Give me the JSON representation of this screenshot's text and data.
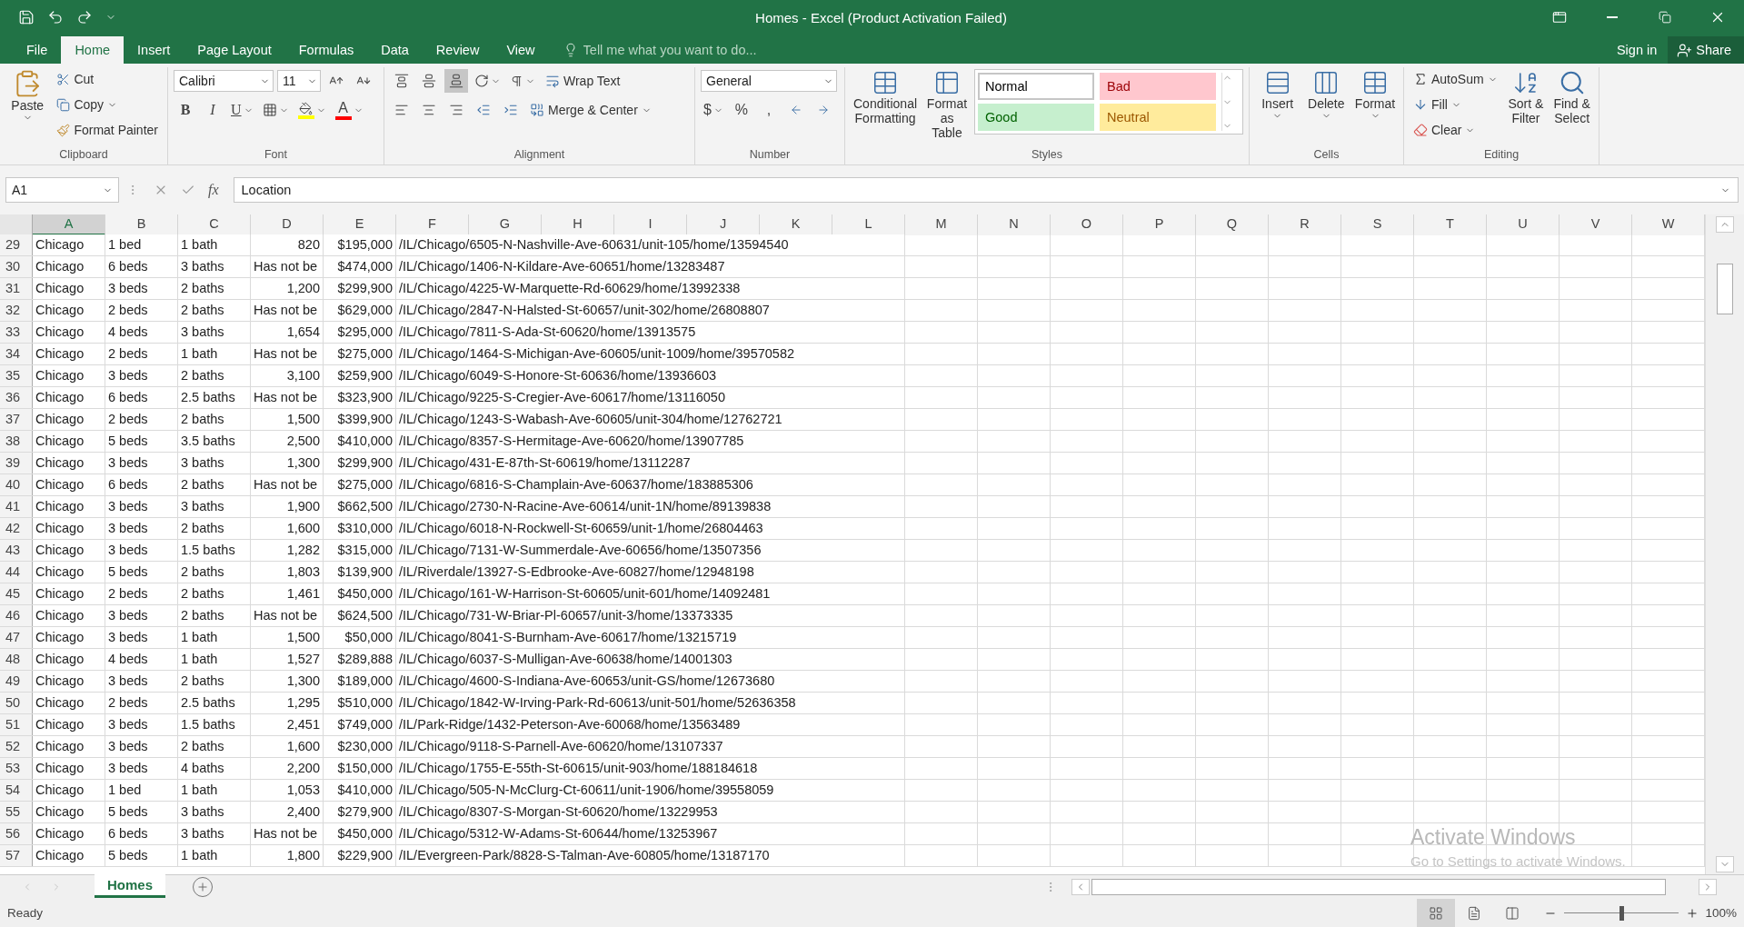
{
  "window": {
    "title": "Homes - Excel (Product Activation Failed)"
  },
  "menu_tabs": [
    {
      "label": "File",
      "selected": false
    },
    {
      "label": "Home",
      "selected": true
    },
    {
      "label": "Insert",
      "selected": false
    },
    {
      "label": "Page Layout",
      "selected": false
    },
    {
      "label": "Formulas",
      "selected": false
    },
    {
      "label": "Data",
      "selected": false
    },
    {
      "label": "Review",
      "selected": false
    },
    {
      "label": "View",
      "selected": false
    }
  ],
  "tell_me": {
    "placeholder": "Tell me what you want to do..."
  },
  "account": {
    "sign_in": "Sign in",
    "share": "Share"
  },
  "ribbon": {
    "clipboard": {
      "label": "Clipboard",
      "paste": "Paste",
      "cut": "Cut",
      "copy": "Copy",
      "format_painter": "Format Painter"
    },
    "font": {
      "label": "Font",
      "name": "Calibri",
      "size": "11",
      "bold": "B",
      "italic": "I",
      "underline": "U",
      "font_color": "A"
    },
    "alignment": {
      "label": "Alignment",
      "wrap_text": "Wrap Text",
      "merge_center": "Merge & Center"
    },
    "number": {
      "label": "Number",
      "format": "General",
      "currency": "$",
      "percent": "%",
      "comma": ","
    },
    "styles": {
      "label": "Styles",
      "conditional_formatting": "Conditional Formatting",
      "format_as_table": "Format as Table",
      "cell_styles": [
        {
          "label": "Normal",
          "kind": "normal"
        },
        {
          "label": "Bad",
          "kind": "bad"
        },
        {
          "label": "Good",
          "kind": "good"
        },
        {
          "label": "Neutral",
          "kind": "neutral"
        }
      ]
    },
    "cells": {
      "label": "Cells",
      "buttons": [
        "Insert",
        "Delete",
        "Format"
      ]
    },
    "editing": {
      "label": "Editing",
      "autosum": "AutoSum",
      "fill": "Fill",
      "clear": "Clear",
      "sort_filter": "Sort & Filter",
      "find_select": "Find & Select"
    }
  },
  "formula_bar": {
    "name_box": "A1",
    "fx": "fx",
    "value": "Location"
  },
  "columns": [
    {
      "label": "A",
      "selected": true
    },
    {
      "label": "B",
      "selected": false
    },
    {
      "label": "C",
      "selected": false
    },
    {
      "label": "D",
      "selected": false
    },
    {
      "label": "E",
      "selected": false
    },
    {
      "label": "F",
      "selected": false
    },
    {
      "label": "G",
      "selected": false
    },
    {
      "label": "H",
      "selected": false
    },
    {
      "label": "I",
      "selected": false
    },
    {
      "label": "J",
      "selected": false
    },
    {
      "label": "K",
      "selected": false
    },
    {
      "label": "L",
      "selected": false
    },
    {
      "label": "M",
      "selected": false
    },
    {
      "label": "N",
      "selected": false
    },
    {
      "label": "O",
      "selected": false
    },
    {
      "label": "P",
      "selected": false
    },
    {
      "label": "Q",
      "selected": false
    },
    {
      "label": "R",
      "selected": false
    },
    {
      "label": "S",
      "selected": false
    },
    {
      "label": "T",
      "selected": false
    },
    {
      "label": "U",
      "selected": false
    },
    {
      "label": "V",
      "selected": false
    },
    {
      "label": "W",
      "selected": false
    }
  ],
  "rows": [
    {
      "number": "29",
      "kind": "number",
      "cells": [
        "Chicago",
        "1 bed",
        "1 bath",
        "820",
        "$195,000",
        "/IL/Chicago/6505-N-Nashville-Ave-60631/unit-105/home/13594540"
      ]
    },
    {
      "number": "30",
      "kind": "text",
      "cells": [
        "Chicago",
        "6 beds",
        "3 baths",
        "Has not be",
        "$474,000",
        "/IL/Chicago/1406-N-Kildare-Ave-60651/home/13283487"
      ]
    },
    {
      "number": "31",
      "kind": "number",
      "cells": [
        "Chicago",
        "3 beds",
        "2 baths",
        "1,200",
        "$299,900",
        "/IL/Chicago/4225-W-Marquette-Rd-60629/home/13992338"
      ]
    },
    {
      "number": "32",
      "kind": "text",
      "cells": [
        "Chicago",
        "2 beds",
        "2 baths",
        "Has not be",
        "$629,000",
        "/IL/Chicago/2847-N-Halsted-St-60657/unit-302/home/26808807"
      ]
    },
    {
      "number": "33",
      "kind": "number",
      "cells": [
        "Chicago",
        "4 beds",
        "3 baths",
        "1,654",
        "$295,000",
        "/IL/Chicago/7811-S-Ada-St-60620/home/13913575"
      ]
    },
    {
      "number": "34",
      "kind": "text",
      "cells": [
        "Chicago",
        "2 beds",
        "1 bath",
        "Has not be",
        "$275,000",
        "/IL/Chicago/1464-S-Michigan-Ave-60605/unit-1009/home/39570582"
      ]
    },
    {
      "number": "35",
      "kind": "number",
      "cells": [
        "Chicago",
        "3 beds",
        "2 baths",
        "3,100",
        "$259,900",
        "/IL/Chicago/6049-S-Honore-St-60636/home/13936603"
      ]
    },
    {
      "number": "36",
      "kind": "text",
      "cells": [
        "Chicago",
        "6 beds",
        "2.5 baths",
        "Has not be",
        "$323,900",
        "/IL/Chicago/9225-S-Cregier-Ave-60617/home/13116050"
      ]
    },
    {
      "number": "37",
      "kind": "number",
      "cells": [
        "Chicago",
        "2 beds",
        "2 baths",
        "1,500",
        "$399,900",
        "/IL/Chicago/1243-S-Wabash-Ave-60605/unit-304/home/12762721"
      ]
    },
    {
      "number": "38",
      "kind": "number",
      "cells": [
        "Chicago",
        "5 beds",
        "3.5 baths",
        "2,500",
        "$410,000",
        "/IL/Chicago/8357-S-Hermitage-Ave-60620/home/13907785"
      ]
    },
    {
      "number": "39",
      "kind": "number",
      "cells": [
        "Chicago",
        "3 beds",
        "3 baths",
        "1,300",
        "$299,900",
        "/IL/Chicago/431-E-87th-St-60619/home/13112287"
      ]
    },
    {
      "number": "40",
      "kind": "text",
      "cells": [
        "Chicago",
        "6 beds",
        "2 baths",
        "Has not be",
        "$275,000",
        "/IL/Chicago/6816-S-Champlain-Ave-60637/home/183885306"
      ]
    },
    {
      "number": "41",
      "kind": "number",
      "cells": [
        "Chicago",
        "3 beds",
        "3 baths",
        "1,900",
        "$662,500",
        "/IL/Chicago/2730-N-Racine-Ave-60614/unit-1N/home/89139838"
      ]
    },
    {
      "number": "42",
      "kind": "number",
      "cells": [
        "Chicago",
        "3 beds",
        "2 baths",
        "1,600",
        "$310,000",
        "/IL/Chicago/6018-N-Rockwell-St-60659/unit-1/home/26804463"
      ]
    },
    {
      "number": "43",
      "kind": "number",
      "cells": [
        "Chicago",
        "3 beds",
        "1.5 baths",
        "1,282",
        "$315,000",
        "/IL/Chicago/7131-W-Summerdale-Ave-60656/home/13507356"
      ]
    },
    {
      "number": "44",
      "kind": "number",
      "cells": [
        "Chicago",
        "5 beds",
        "2 baths",
        "1,803",
        "$139,900",
        "/IL/Riverdale/13927-S-Edbrooke-Ave-60827/home/12948198"
      ]
    },
    {
      "number": "45",
      "kind": "number",
      "cells": [
        "Chicago",
        "2 beds",
        "2 baths",
        "1,461",
        "$450,000",
        "/IL/Chicago/161-W-Harrison-St-60605/unit-601/home/14092481"
      ]
    },
    {
      "number": "46",
      "kind": "text",
      "cells": [
        "Chicago",
        "3 beds",
        "2 baths",
        "Has not be",
        "$624,500",
        "/IL/Chicago/731-W-Briar-Pl-60657/unit-3/home/13373335"
      ]
    },
    {
      "number": "47",
      "kind": "number",
      "cells": [
        "Chicago",
        "3 beds",
        "1 bath",
        "1,500",
        "$50,000",
        "/IL/Chicago/8041-S-Burnham-Ave-60617/home/13215719"
      ]
    },
    {
      "number": "48",
      "kind": "number",
      "cells": [
        "Chicago",
        "4 beds",
        "1 bath",
        "1,527",
        "$289,888",
        "/IL/Chicago/6037-S-Mulligan-Ave-60638/home/14001303"
      ]
    },
    {
      "number": "49",
      "kind": "number",
      "cells": [
        "Chicago",
        "3 beds",
        "2 baths",
        "1,300",
        "$189,000",
        "/IL/Chicago/4600-S-Indiana-Ave-60653/unit-GS/home/12673680"
      ]
    },
    {
      "number": "50",
      "kind": "number",
      "cells": [
        "Chicago",
        "2 beds",
        "2.5 baths",
        "1,295",
        "$510,000",
        "/IL/Chicago/1842-W-Irving-Park-Rd-60613/unit-501/home/52636358"
      ]
    },
    {
      "number": "51",
      "kind": "number",
      "cells": [
        "Chicago",
        "3 beds",
        "1.5 baths",
        "2,451",
        "$749,000",
        "/IL/Park-Ridge/1432-Peterson-Ave-60068/home/13563489"
      ]
    },
    {
      "number": "52",
      "kind": "number",
      "cells": [
        "Chicago",
        "3 beds",
        "2 baths",
        "1,600",
        "$230,000",
        "/IL/Chicago/9118-S-Parnell-Ave-60620/home/13107337"
      ]
    },
    {
      "number": "53",
      "kind": "number",
      "cells": [
        "Chicago",
        "3 beds",
        "4 baths",
        "2,200",
        "$150,000",
        "/IL/Chicago/1755-E-55th-St-60615/unit-903/home/188184618"
      ]
    },
    {
      "number": "54",
      "kind": "number",
      "cells": [
        "Chicago",
        "1 bed",
        "1 bath",
        "1,053",
        "$410,000",
        "/IL/Chicago/505-N-McClurg-Ct-60611/unit-1906/home/39558059"
      ]
    },
    {
      "number": "55",
      "kind": "number",
      "cells": [
        "Chicago",
        "5 beds",
        "3 baths",
        "2,400",
        "$279,900",
        "/IL/Chicago/8307-S-Morgan-St-60620/home/13229953"
      ]
    },
    {
      "number": "56",
      "kind": "text",
      "cells": [
        "Chicago",
        "6 beds",
        "3 baths",
        "Has not be",
        "$450,000",
        "/IL/Chicago/5312-W-Adams-St-60644/home/13253967"
      ]
    },
    {
      "number": "57",
      "kind": "number",
      "cells": [
        "Chicago",
        "5 beds",
        "1 bath",
        "1,800",
        "$229,900",
        "/IL/Evergreen-Park/8828-S-Talman-Ave-60805/home/13187170"
      ]
    }
  ],
  "sheet_tabs": [
    {
      "label": "Homes",
      "selected": true
    }
  ],
  "status_bar": {
    "status": "Ready",
    "views": [
      {
        "kind": "normal",
        "selected": true
      },
      {
        "kind": "page_layout",
        "selected": false
      },
      {
        "kind": "page_break",
        "selected": false
      }
    ],
    "zoom": {
      "level": 0.5,
      "reading": "100%"
    }
  },
  "activation_notice": {
    "title": "Activate Windows",
    "message": "Go to Settings to activate Windows."
  }
}
